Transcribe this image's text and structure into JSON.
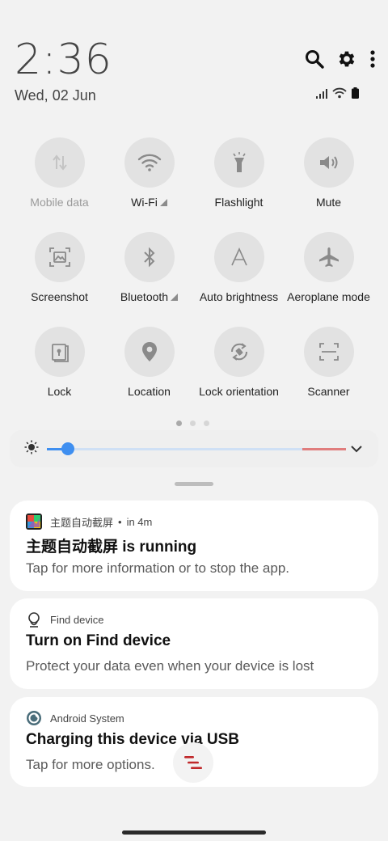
{
  "status": {
    "time": "2:36",
    "date": "Wed, 02 Jun"
  },
  "header_icons": [
    "search-icon",
    "settings-icon",
    "more-vert-icon"
  ],
  "status_icons": [
    "signal-icon",
    "wifi-icon",
    "battery-icon"
  ],
  "tiles": [
    {
      "label": "Mobile data",
      "icon": "mobile-data-icon",
      "dim": true,
      "caret": false
    },
    {
      "label": "Wi-Fi",
      "icon": "wifi-icon",
      "dim": false,
      "caret": true
    },
    {
      "label": "Flashlight",
      "icon": "flashlight-icon",
      "dim": false,
      "caret": false
    },
    {
      "label": "Mute",
      "icon": "volume-icon",
      "dim": false,
      "caret": false
    },
    {
      "label": "Screenshot",
      "icon": "screenshot-icon",
      "dim": false,
      "caret": false
    },
    {
      "label": "Bluetooth",
      "icon": "bluetooth-icon",
      "dim": false,
      "caret": true
    },
    {
      "label": "Auto brightness",
      "icon": "auto-brightness-icon",
      "dim": false,
      "caret": false
    },
    {
      "label": "Aeroplane mode",
      "icon": "airplane-icon",
      "dim": false,
      "caret": false
    },
    {
      "label": "Lock",
      "icon": "lock-icon",
      "dim": false,
      "caret": false
    },
    {
      "label": "Location",
      "icon": "location-icon",
      "dim": false,
      "caret": false
    },
    {
      "label": "Lock orientation",
      "icon": "rotation-lock-icon",
      "dim": false,
      "caret": false
    },
    {
      "label": "Scanner",
      "icon": "scanner-icon",
      "dim": false,
      "caret": false
    }
  ],
  "page_indicator": {
    "count": 3,
    "active": 0
  },
  "brightness": {
    "level": 0.07,
    "icon": "sun-icon",
    "expand_icon": "chevron-down-icon"
  },
  "notifications": [
    {
      "app": "主题自动截屏",
      "app_time": "in 4m",
      "title": "主题自动截屏 is running",
      "body": "Tap for more information or to stop the app.",
      "icon": "app-color-icon"
    },
    {
      "app": "Find device",
      "title": "Turn on Find device",
      "body": "Protect your data even when your device is lost",
      "icon": "find-device-icon"
    },
    {
      "app": "Android System",
      "title": "Charging this device via USB",
      "body": "Tap for more options.",
      "icon": "android-system-icon"
    }
  ],
  "floating_icon": "assistant-menu-icon",
  "colors": {
    "accent": "#3f8ff0",
    "tile_bg": "#e2e2e2",
    "background": "#f2f2f2"
  }
}
